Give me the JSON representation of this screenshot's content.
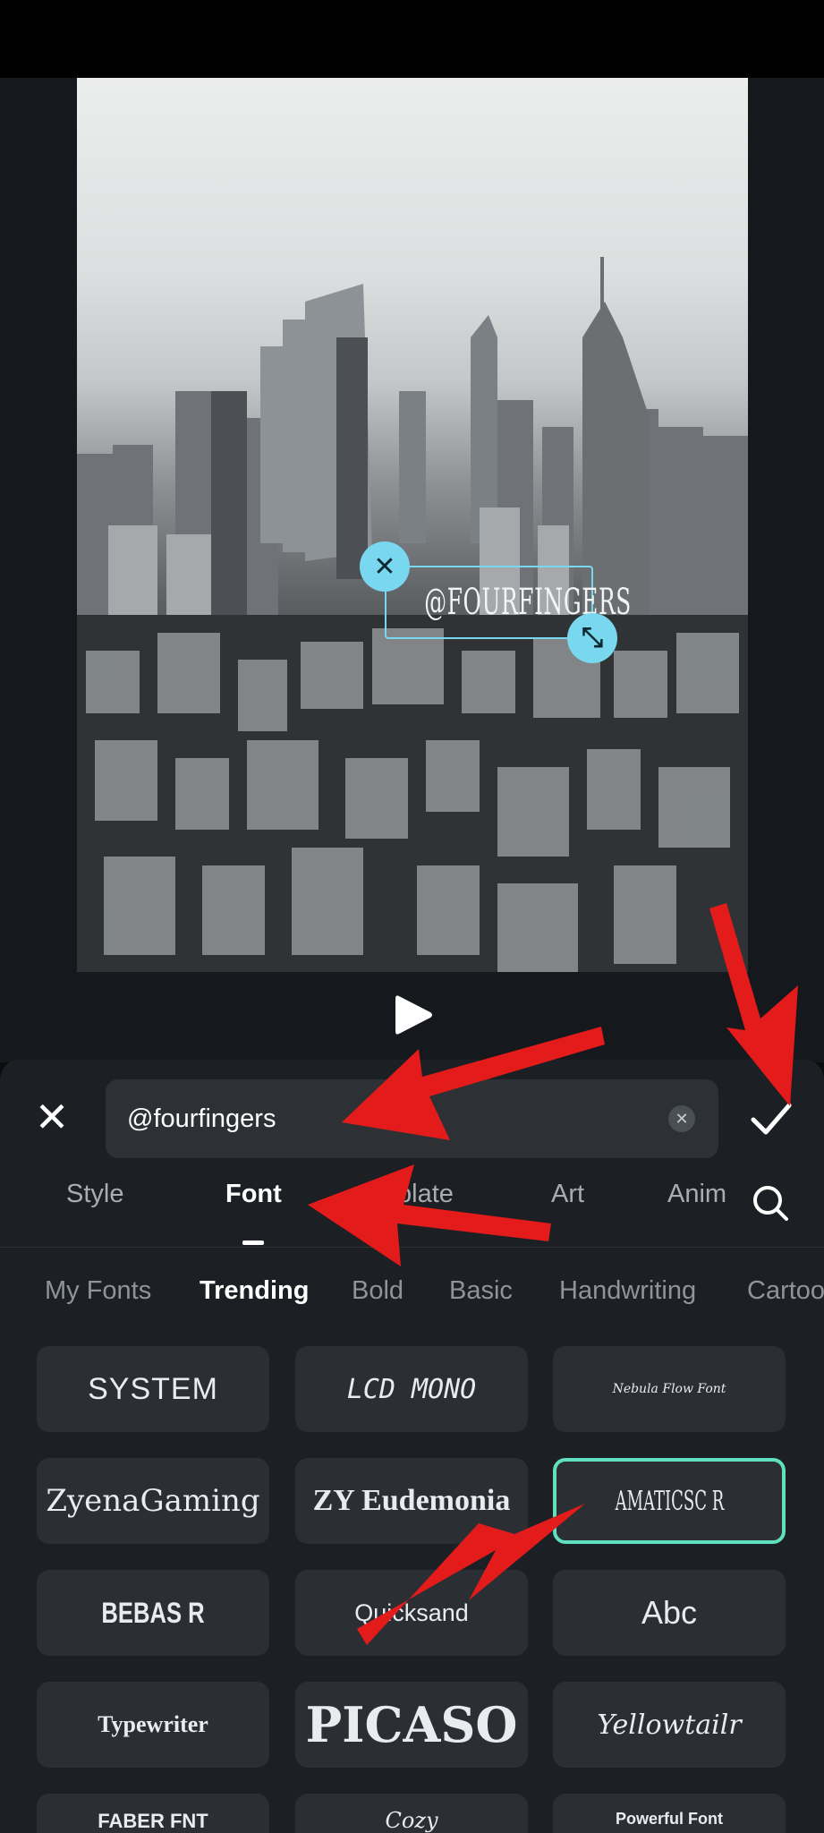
{
  "editor": {
    "overlay_text": "@FOURFINGERS",
    "delete_glyph": "✕",
    "resize_glyph": "⤡"
  },
  "panel": {
    "close_glyph": "✕",
    "input_value": "@fourfingers",
    "clear_glyph": "✕",
    "tabs": [
      {
        "label": "Style",
        "active": false
      },
      {
        "label": "Font",
        "active": true
      },
      {
        "label": "plate",
        "active": false
      },
      {
        "label": "Art",
        "active": false
      },
      {
        "label": "Anim",
        "active": false
      }
    ],
    "categories": [
      {
        "label": "My Fonts",
        "active": false
      },
      {
        "label": "Trending",
        "active": true
      },
      {
        "label": "Bold",
        "active": false
      },
      {
        "label": "Basic",
        "active": false
      },
      {
        "label": "Handwriting",
        "active": false
      },
      {
        "label": "Cartoo",
        "active": false
      }
    ],
    "fonts": [
      {
        "label": "SYSTEM",
        "selected": false
      },
      {
        "label": "LCD MONO",
        "selected": false
      },
      {
        "label": "Nebula Flow Font",
        "selected": false
      },
      {
        "label": "ZyenaGaming",
        "selected": false
      },
      {
        "label": "ZY Eudemonia",
        "selected": false
      },
      {
        "label": "AMATICSC R",
        "selected": true
      },
      {
        "label": "BEBAS R",
        "selected": false
      },
      {
        "label": "Quicksand",
        "selected": false
      },
      {
        "label": "Abc",
        "selected": false
      },
      {
        "label": "Typewriter",
        "selected": false
      },
      {
        "label": "PICASO",
        "selected": false
      },
      {
        "label": "Yellowtailr",
        "selected": false
      },
      {
        "label": "FABER FNT",
        "selected": false
      },
      {
        "label": "Cozy",
        "selected": false
      },
      {
        "label": "Powerful Font",
        "selected": false
      }
    ]
  },
  "colors": {
    "accent_cyan": "#7ad7f0",
    "selected_border": "#5fe0c0",
    "annotation_red": "#e41b1b",
    "panel_bg": "#1c1f23",
    "tile_bg": "#2b2f34"
  }
}
